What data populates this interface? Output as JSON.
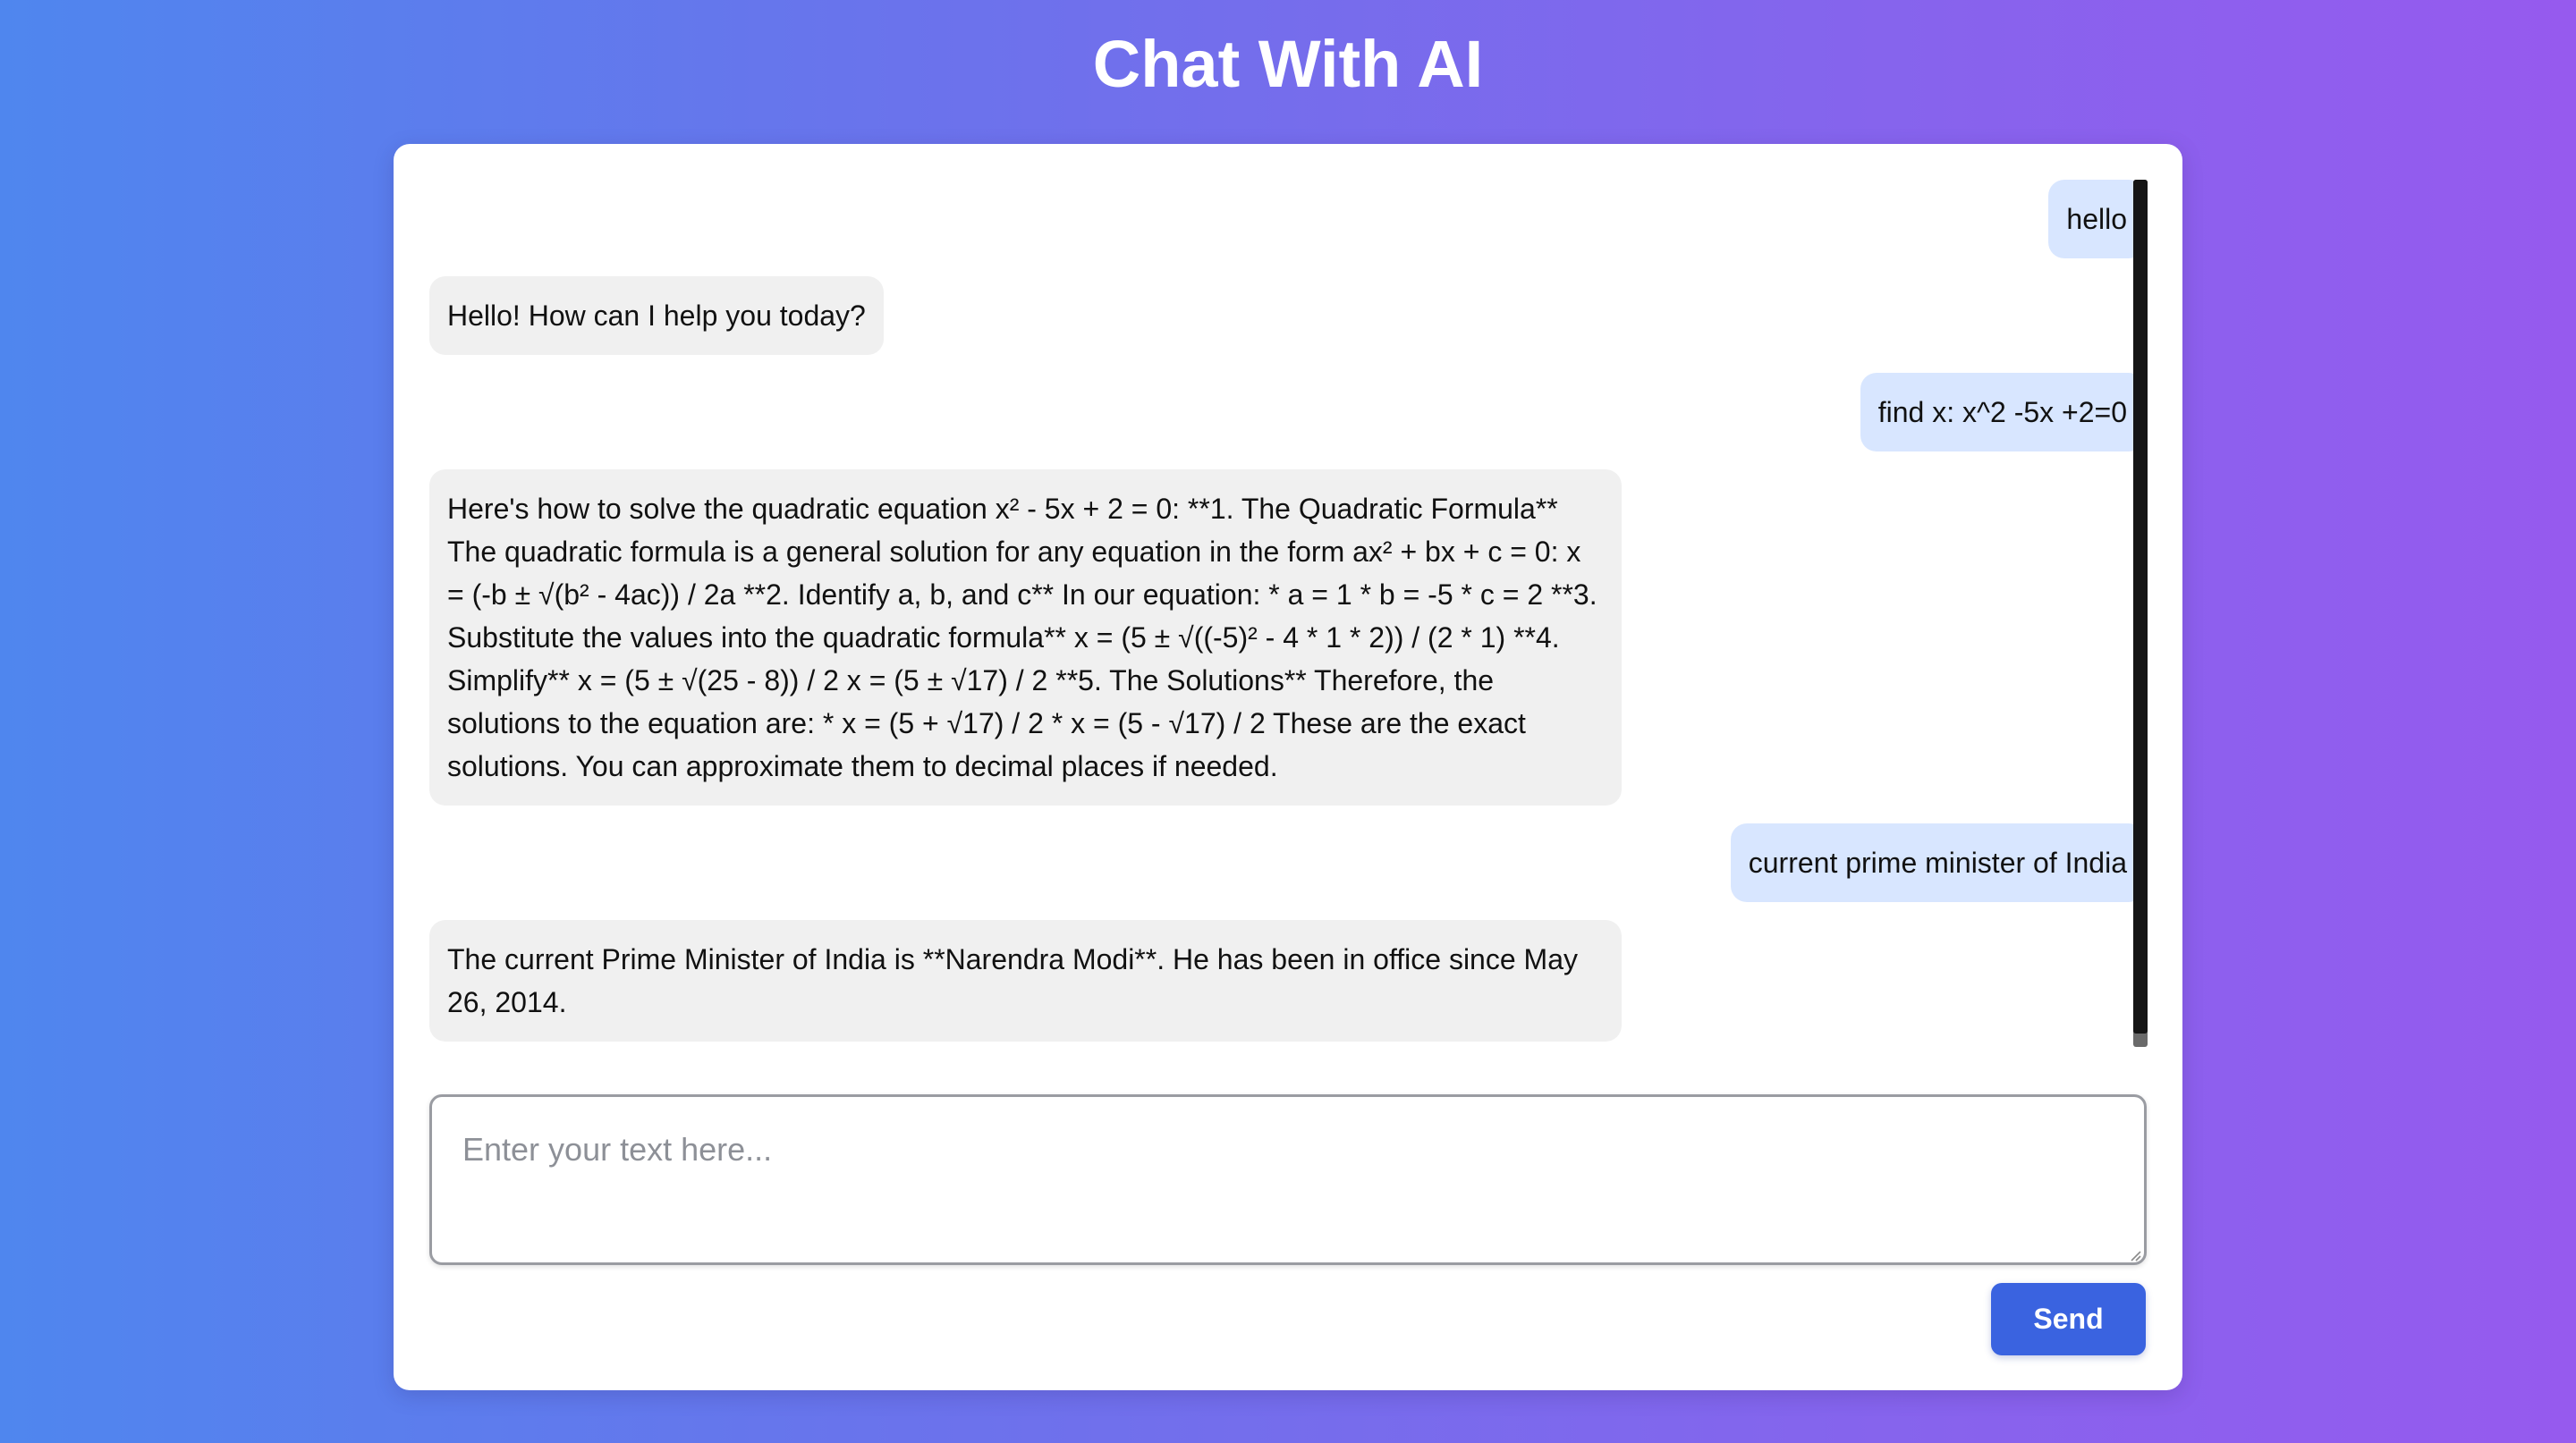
{
  "header": {
    "title": "Chat With AI"
  },
  "chat": {
    "messages": [
      {
        "role": "user",
        "text": "hello"
      },
      {
        "role": "ai",
        "text": "Hello! How can I help you today?"
      },
      {
        "role": "user",
        "text": "find x: x^2 -5x +2=0"
      },
      {
        "role": "ai",
        "text": "Here's how to solve the quadratic equation x² - 5x + 2 = 0: **1. The Quadratic Formula** The quadratic formula is a general solution for any equation in the form ax² + bx + c = 0: x = (-b ± √(b² - 4ac)) / 2a **2. Identify a, b, and c** In our equation: * a = 1 * b = -5 * c = 2 **3. Substitute the values into the quadratic formula** x = (5 ± √((-5)² - 4 * 1 * 2)) / (2 * 1) **4. Simplify** x = (5 ± √(25 - 8)) / 2 x = (5 ± √17) / 2 **5. The Solutions** Therefore, the solutions to the equation are: * x = (5 + √17) / 2 * x = (5 - √17) / 2 These are the exact solutions. You can approximate them to decimal places if needed."
      },
      {
        "role": "user",
        "text": "current prime minister of India"
      },
      {
        "role": "ai",
        "text": "The current Prime Minister of India is **Narendra Modi**. He has been in office since May 26, 2014."
      }
    ]
  },
  "composer": {
    "placeholder": "Enter your text here...",
    "value": "",
    "send_label": "Send"
  },
  "colors": {
    "user_bubble": "#d8e6ff",
    "ai_bubble": "#f0f0f0",
    "accent": "#3a63e0"
  }
}
